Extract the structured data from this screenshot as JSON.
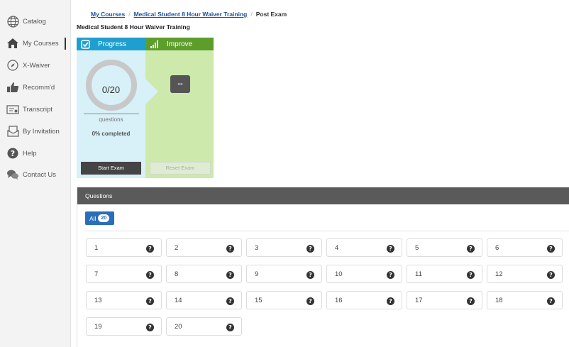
{
  "sidebar": {
    "items": [
      {
        "label": "Catalog",
        "icon": "globe-icon"
      },
      {
        "label": "My Courses",
        "icon": "home-icon"
      },
      {
        "label": "X-Waiver",
        "icon": "compass-icon"
      },
      {
        "label": "Recomm'd",
        "icon": "thumbs-up-icon"
      },
      {
        "label": "Transcript",
        "icon": "transcript-icon"
      },
      {
        "label": "By Invitation",
        "icon": "inbox-icon"
      },
      {
        "label": "Help",
        "icon": "help-icon"
      },
      {
        "label": "Contact Us",
        "icon": "chat-icon"
      }
    ],
    "active": "My Courses"
  },
  "breadcrumb": {
    "items": [
      "My Courses",
      "Medical Student 8 Hour Waiver Training"
    ],
    "current": "Post Exam"
  },
  "page_title": "Medical Student 8 Hour Waiver Training",
  "progress": {
    "header": "Progress",
    "value": "0/20",
    "label": "questions",
    "percent_text": "0% completed",
    "fraction": 0,
    "start_button": "Start Exam"
  },
  "improve": {
    "header": "Improve",
    "value": "--",
    "reset_button": "Reset Exam"
  },
  "questions": {
    "header": "Questions",
    "filter_label": "All",
    "count": "20",
    "items": [
      "1",
      "2",
      "3",
      "4",
      "5",
      "6",
      "7",
      "8",
      "9",
      "10",
      "11",
      "12",
      "13",
      "14",
      "15",
      "16",
      "17",
      "18",
      "19",
      "20"
    ]
  },
  "colors": {
    "progress_blue": "#1f9fcf",
    "progress_bg": "#d8f0f7",
    "improve_green": "#5d9d2b",
    "improve_bg": "#cde9ac",
    "link_blue": "#1a4f9c",
    "filter_blue": "#2a6ebb"
  }
}
